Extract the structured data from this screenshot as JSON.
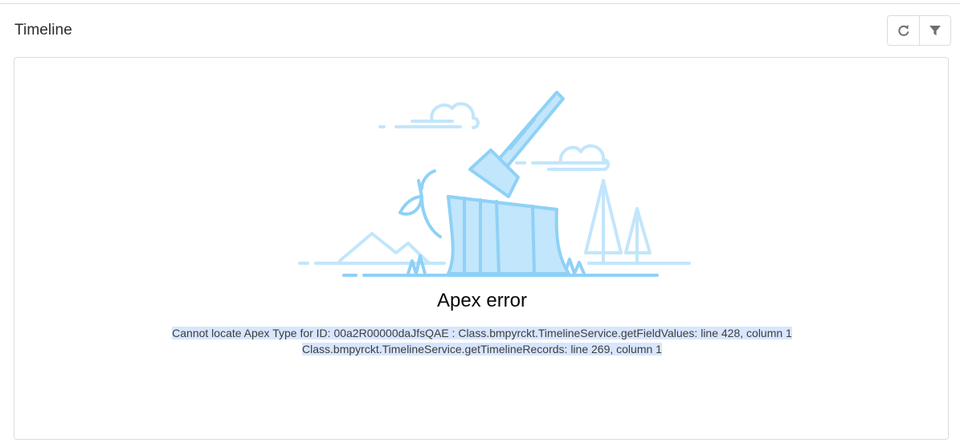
{
  "header": {
    "title": "Timeline",
    "refresh_icon": "refresh-icon",
    "filter_icon": "filter-icon"
  },
  "error": {
    "title": "Apex error",
    "message_line1": "Cannot locate Apex Type for ID: 00a2R00000daJfsQAE : Class.bmpyrckt.TimelineService.getFieldValues: line 428, column 1",
    "message_line2": "Class.bmpyrckt.TimelineService.getTimelineRecords: line 269, column 1",
    "illustration_icon": "axe-in-stump-illustration"
  },
  "colors": {
    "illustration_stroke": "#8fd1f6",
    "illustration_fill": "#c2e6fb",
    "highlight": "#d8e6fe",
    "border": "#dddbda",
    "icon": "#706e6b"
  }
}
